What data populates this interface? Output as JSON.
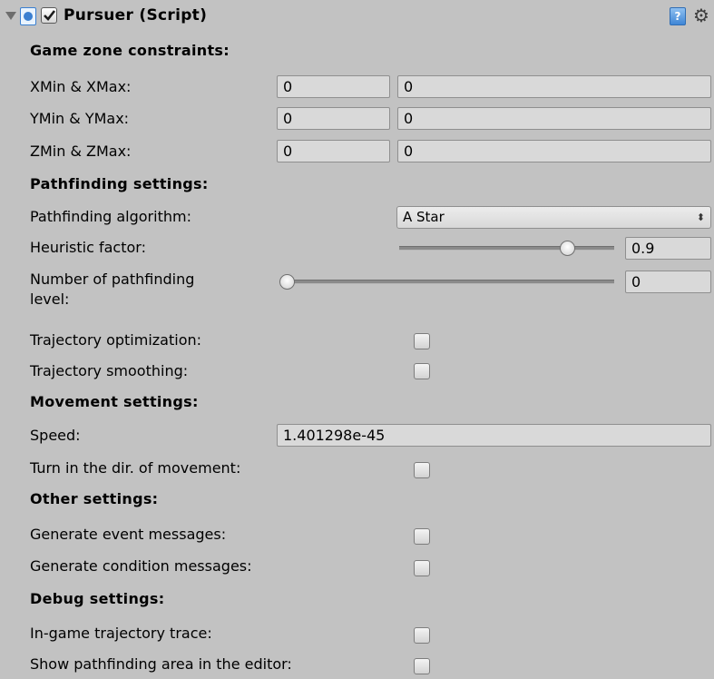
{
  "component": {
    "title": "Pursuer (Script)",
    "enabled": true
  },
  "sections": {
    "game_zone": "Game zone constraints:",
    "pathfinding": "Pathfinding settings:",
    "movement": "Movement settings:",
    "other": "Other settings:",
    "debug": "Debug settings:"
  },
  "game_zone": {
    "x": {
      "label": "XMin & XMax:",
      "min": "0",
      "max": "0"
    },
    "y": {
      "label": "YMin & YMax:",
      "min": "0",
      "max": "0"
    },
    "z": {
      "label": "ZMin & ZMax:",
      "min": "0",
      "max": "0"
    }
  },
  "pathfinding": {
    "algorithm_label": "Pathfinding algorithm:",
    "algorithm_value": "A Star",
    "heuristic_label": "Heuristic factor:",
    "heuristic_value": "0.9",
    "levels_label_1": "Number of pathfinding",
    "levels_label_2": "level:",
    "levels_value": "0",
    "optimization_label": "Trajectory optimization:",
    "optimization_checked": false,
    "smoothing_label": "Trajectory smoothing:",
    "smoothing_checked": false
  },
  "movement": {
    "speed_label": "Speed:",
    "speed_value": "1.401298e-45",
    "turn_label": "Turn in the dir. of movement:",
    "turn_checked": false
  },
  "other": {
    "event_label": "Generate event messages:",
    "event_checked": false,
    "condition_label": "Generate condition messages:",
    "condition_checked": false
  },
  "debug": {
    "trace_label": "In-game trajectory trace:",
    "trace_checked": false,
    "area_label": "Show pathfinding area in the editor:",
    "area_checked": false
  },
  "colors": {
    "panel_bg": "#c2c2c2",
    "field_bg": "#d9d9d9",
    "script_icon": "#3a7fd0"
  },
  "icons": [
    "foldout-arrow-icon",
    "script-icon",
    "help-icon",
    "gear-icon"
  ]
}
